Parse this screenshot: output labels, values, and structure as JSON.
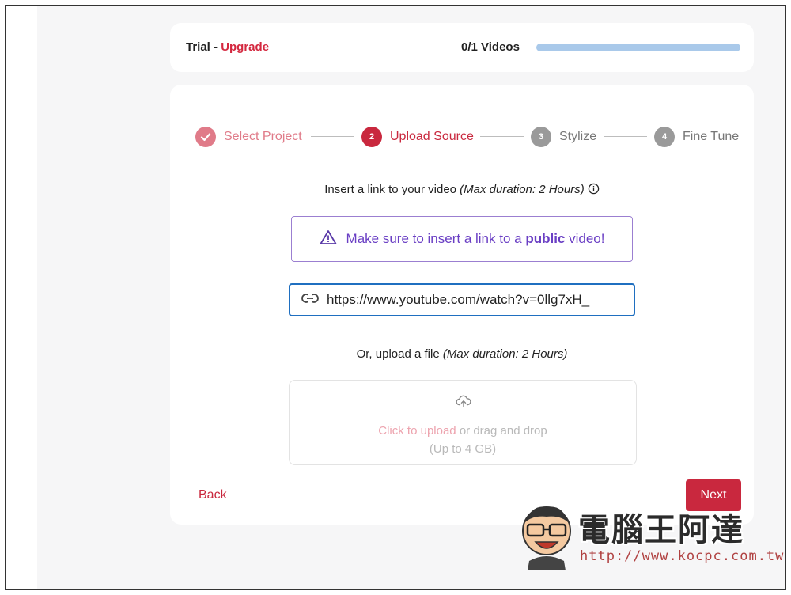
{
  "header": {
    "plan_label": "Trial - ",
    "upgrade_label": "Upgrade",
    "usage_label": "0/1 Videos",
    "usage_progress": 0
  },
  "stepper": {
    "steps": [
      {
        "number": "",
        "label": "Select Project",
        "state": "done"
      },
      {
        "number": "2",
        "label": "Upload Source",
        "state": "active"
      },
      {
        "number": "3",
        "label": "Stylize",
        "state": "todo"
      },
      {
        "number": "4",
        "label": "Fine Tune",
        "state": "todo"
      }
    ]
  },
  "link_section": {
    "prompt": "Insert a link to your video ",
    "duration_note": "(Max duration: 2 Hours)",
    "info_icon": "info-icon"
  },
  "notice": {
    "icon": "warning-triangle-icon",
    "text_before": "Make sure to insert a link to a ",
    "text_bold": "public",
    "text_after": " video!"
  },
  "url_input": {
    "icon": "link-icon",
    "value": "https://www.youtube.com/watch?v=0llg7xH_"
  },
  "upload_section": {
    "prompt": "Or, upload a file ",
    "duration_note": "(Max duration: 2 Hours)",
    "icon": "cloud-upload-icon",
    "click_text": "Click to upload",
    "rest_text": " or drag and drop",
    "limit_text": "(Up to 4 GB)"
  },
  "actions": {
    "back_label": "Back",
    "next_label": "Next"
  },
  "watermark": {
    "title": "電腦王阿達",
    "url": "http://www.kocpc.com.tw"
  },
  "colors": {
    "accent": "#c9283e",
    "accent_light": "#e07b89",
    "notice_purple": "#6a3fc4",
    "input_border": "#1f6fc0",
    "progress_track": "#a9c9ea"
  }
}
